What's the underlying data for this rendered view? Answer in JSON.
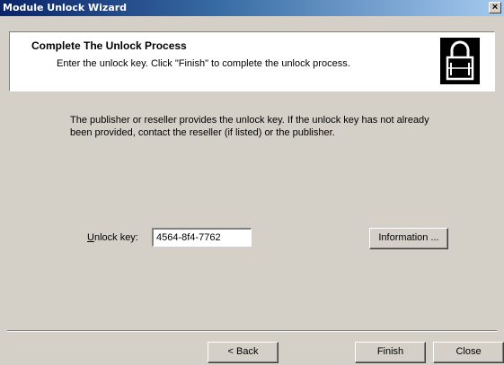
{
  "window": {
    "title": "Module Unlock Wizard",
    "close_glyph": "×"
  },
  "header": {
    "title": "Complete The Unlock Process",
    "subtitle": "Enter the unlock key.  Click \"Finish\" to complete the unlock process.",
    "icon": "padlock-icon"
  },
  "body": {
    "description": "The publisher or reseller provides the unlock key.  If the unlock key has not already been provided, contact the reseller (if listed) or the publisher."
  },
  "unlock": {
    "label_mnemonic": "U",
    "label_rest": "nlock key:",
    "value": "4564-8f4-7762"
  },
  "buttons": {
    "information": "Information ...",
    "back": "< Back",
    "finish": "Finish",
    "close": "Close"
  }
}
